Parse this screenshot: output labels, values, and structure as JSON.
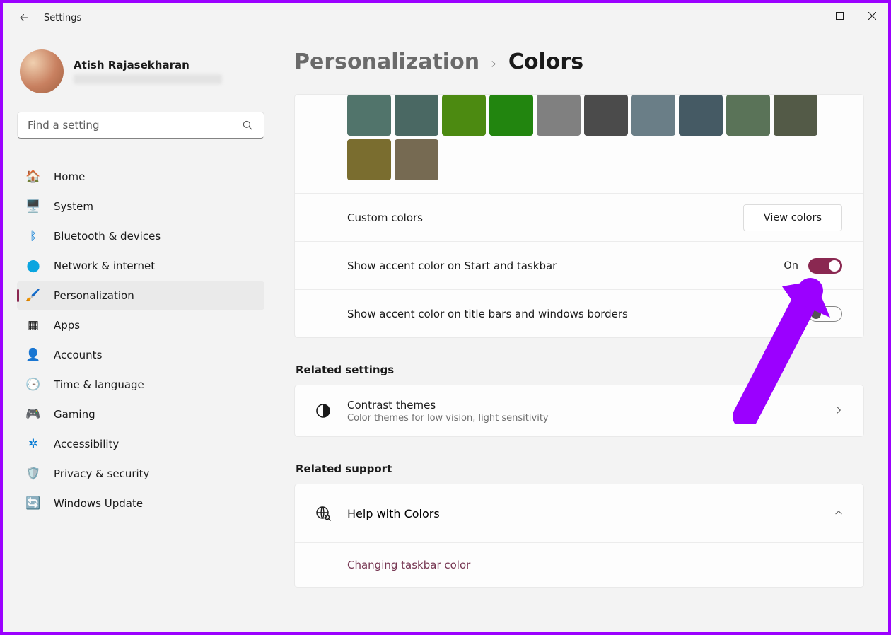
{
  "app_title": "Settings",
  "window": {
    "min": "minimize",
    "max": "maximize",
    "close": "close"
  },
  "user": {
    "name": "Atish Rajasekharan"
  },
  "search": {
    "placeholder": "Find a setting"
  },
  "nav": {
    "home": "Home",
    "system": "System",
    "bluetooth": "Bluetooth & devices",
    "network": "Network & internet",
    "personalization": "Personalization",
    "apps": "Apps",
    "accounts": "Accounts",
    "time": "Time & language",
    "gaming": "Gaming",
    "accessibility": "Accessibility",
    "privacy": "Privacy & security",
    "update": "Windows Update"
  },
  "breadcrumb": {
    "parent": "Personalization",
    "current": "Colors"
  },
  "swatch_colors": [
    "#51746b",
    "#4a6863",
    "#4c8a11",
    "#22850f",
    "#808080",
    "#4b4b4b",
    "#6a7e87",
    "#455a64",
    "#5a7358",
    "#535a47",
    "#7a6d2f",
    "#766a52"
  ],
  "rows": {
    "custom_colors": {
      "label": "Custom colors",
      "button": "View colors"
    },
    "accent_start": {
      "label": "Show accent color on Start and taskbar",
      "state_label": "On",
      "on": true
    },
    "accent_title": {
      "label": "Show accent color on title bars and windows borders",
      "on": false
    }
  },
  "related": {
    "header": "Related settings",
    "contrast": {
      "title": "Contrast themes",
      "sub": "Color themes for low vision, light sensitivity"
    }
  },
  "support": {
    "header": "Related support",
    "help": {
      "title": "Help with Colors"
    },
    "item1": "Changing taskbar color"
  },
  "accent_color": "#8a2851"
}
